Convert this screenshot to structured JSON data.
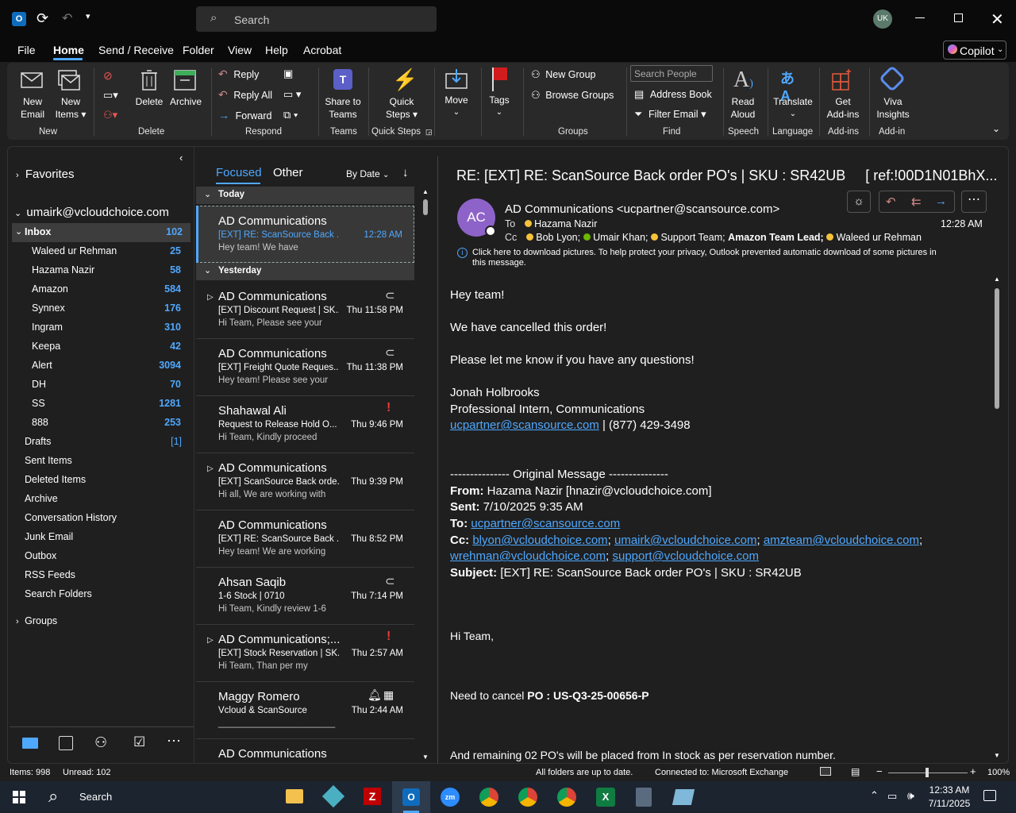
{
  "titlebar": {
    "search_placeholder": "Search",
    "user_initials": "UK"
  },
  "menu": [
    "File",
    "Home",
    "Send / Receive",
    "Folder",
    "View",
    "Help",
    "Acrobat"
  ],
  "copilot_label": "Copilot",
  "ribbon": {
    "new_email": [
      "New",
      "Email"
    ],
    "new_items": [
      "New",
      "Items"
    ],
    "delete": "Delete",
    "archive": "Archive",
    "reply": "Reply",
    "reply_all": "Reply All",
    "forward": "Forward",
    "share_teams": [
      "Share to",
      "Teams"
    ],
    "quick_steps": [
      "Quick",
      "Steps"
    ],
    "move": "Move",
    "tags": "Tags",
    "new_group": "New Group",
    "browse_groups": "Browse Groups",
    "search_people_placeholder": "Search People",
    "address_book": "Address Book",
    "filter_email": "Filter Email",
    "read_aloud": [
      "Read",
      "Aloud"
    ],
    "translate": "Translate",
    "get_addins": [
      "Get",
      "Add-ins"
    ],
    "viva": [
      "Viva",
      "Insights"
    ],
    "groups": [
      "New",
      "Delete",
      "Respond",
      "Teams",
      "Quick Steps",
      "Groups",
      "Find",
      "Speech",
      "Language",
      "Add-ins",
      "Add-in"
    ]
  },
  "nav": {
    "favorites": "Favorites",
    "account": "umairk@vcloudchoice.com",
    "inbox": {
      "label": "Inbox",
      "count": "102"
    },
    "subfolders": [
      {
        "label": "Waleed ur Rehman",
        "count": "25"
      },
      {
        "label": "Hazama Nazir",
        "count": "58"
      },
      {
        "label": "Amazon",
        "count": "584"
      },
      {
        "label": "Synnex",
        "count": "176"
      },
      {
        "label": "Ingram",
        "count": "310"
      },
      {
        "label": "Keepa",
        "count": "42"
      },
      {
        "label": "Alert",
        "count": "3094"
      },
      {
        "label": "DH",
        "count": "70"
      },
      {
        "label": "SS",
        "count": "1281"
      },
      {
        "label": "888",
        "count": "253"
      }
    ],
    "drafts": {
      "label": "Drafts",
      "count": "[1]"
    },
    "folders": [
      "Sent Items",
      "Deleted Items",
      "Archive",
      "Conversation History",
      "Junk Email",
      "Outbox",
      "RSS Feeds",
      "Search Folders"
    ],
    "groups": "Groups"
  },
  "list": {
    "tab_focused": "Focused",
    "tab_other": "Other",
    "sort": "By Date",
    "today": "Today",
    "yesterday": "Yesterday",
    "items": [
      {
        "sender": "AD Communications",
        "subject": "[EXT] RE: ScanSource Back ...",
        "time": "12:28 AM",
        "preview": "Hey team!  We have"
      },
      {
        "sender": "AD Communications",
        "subject": "[EXT] Discount Request | SK...",
        "time": "Thu 11:58 PM",
        "preview": "Hi Team,  Please see your"
      },
      {
        "sender": "AD Communications",
        "subject": "[EXT] Freight Quote Reques...",
        "time": "Thu 11:38 PM",
        "preview": "Hey team!  Please see your"
      },
      {
        "sender": "Shahawal Ali",
        "subject": "Request to Release Hold O...",
        "time": "Thu 9:46 PM",
        "preview": "Hi Team,  Kindly proceed"
      },
      {
        "sender": "AD Communications",
        "subject": "[EXT] ScanSource Back orde...",
        "time": "Thu 9:39 PM",
        "preview": "Hi all,  We are working with"
      },
      {
        "sender": "AD Communications",
        "subject": "[EXT] RE: ScanSource Back ...",
        "time": "Thu 8:52 PM",
        "preview": "Hey team!  We are working"
      },
      {
        "sender": "Ahsan Saqib",
        "subject": "1-6 Stock | 0710",
        "time": "Thu 7:14 PM",
        "preview": "Hi Team,  Kindly review 1-6"
      },
      {
        "sender": "AD Communications;...",
        "subject": "[EXT] Stock Reservation | SK...",
        "time": "Thu 2:57 AM",
        "preview": "Hi Team,  Than per my"
      },
      {
        "sender": "Maggy Romero",
        "subject": "Vcloud & ScanSource",
        "time": "Thu 2:44 AM",
        "preview": "_______________________"
      },
      {
        "sender": "AD Communications",
        "subject": "",
        "time": "",
        "preview": ""
      }
    ]
  },
  "reading": {
    "subject": "RE: [EXT] RE: ScanSource Back order PO's | SKU : SR42UB     [ ref:!00D1N01BhX...",
    "avatar": "AC",
    "from": "AD Communications <ucpartner@scansource.com>",
    "to_label": "To",
    "to": "Hazama Nazir",
    "cc_label": "Cc",
    "cc": [
      "Bob Lyon;",
      "Umair Khan;",
      "Support Team;",
      "Amazon Team Lead;",
      "Waleed ur Rehman"
    ],
    "time": "12:28 AM",
    "info": "Click here to download pictures. To help protect your privacy, Outlook prevented automatic download of some pictures in",
    "info2": "this message.",
    "body": {
      "greet": "Hey team!",
      "l1": "We have cancelled this order!",
      "l2": "Please let me know if you have any questions!",
      "sig_name": "Jonah Holbrooks",
      "sig_title": "Professional Intern, Communications",
      "sig_email": "ucpartner@scansource.com",
      "sig_phone": " | (877) 429-3498",
      "orig": "--------------- Original Message ---------------",
      "from_label": "From:",
      "from_val": " Hazama Nazir [hnazir@vcloudchoice.com]",
      "sent_label": "Sent:",
      "sent_val": " 7/10/2025 9:35 AM",
      "to_label": "To:",
      "to_val": "ucpartner@scansource.com",
      "cc_label": "Cc:",
      "cc1": "blyon@vcloudchoice.com",
      "cc2": "umairk@vcloudchoice.com",
      "cc3": "amzteam@vcloudchoice.com",
      "cc4": "wrehman@vcloudchoice.com",
      "cc5": "support@vcloudchoice.com",
      "subj_label": "Subject:",
      "subj_val": " [EXT] RE: ScanSource Back order PO's | SKU : SR42UB",
      "hi": "Hi Team,",
      "need": "Need to cancel ",
      "po": "PO : US-Q3-25-00656-P",
      "remaining": "And remaining 02 PO's will be placed from In stock as per reservation number."
    }
  },
  "status": {
    "items": "Items: 998",
    "unread": "Unread: 102",
    "sync": "All folders are up to date.",
    "connected": "Connected to: Microsoft Exchange",
    "zoom": "100%"
  },
  "taskbar": {
    "search": "Search",
    "time": "12:33 AM",
    "date": "7/11/2025"
  }
}
